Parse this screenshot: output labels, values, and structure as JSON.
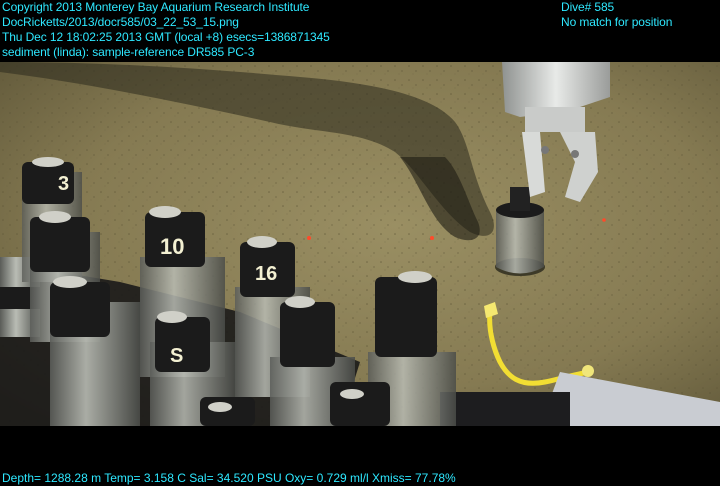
{
  "overlay": {
    "copyright": "Copyright 2013 Monterey Bay Aquarium Research Institute",
    "filename": "DocRicketts/2013/docr585/03_22_53_15.png",
    "timestamp": "Thu Dec 12 18:02:25 2013 GMT (local +8)  esecs=1386871345",
    "sample_note": "sediment (linda): sample-reference DR585 PC-3",
    "dive": "Dive# 585",
    "position_status": "No match for position"
  },
  "footer": {
    "telemetry": "Depth= 1288.28 m  Temp= 3.158 C  Sal= 34.520 PSU  Oxy= 0.729 ml/l  Xmiss= 77.78%"
  },
  "scene": {
    "tube_labels": [
      "3",
      "10",
      "16",
      "S"
    ],
    "colors": {
      "overlay_text": "#2ee8ff",
      "seafloor": "#8b8058",
      "shadow": "#2c2a1e",
      "tube_cap": "#1b1b1b",
      "rope": "#f2de33"
    }
  }
}
